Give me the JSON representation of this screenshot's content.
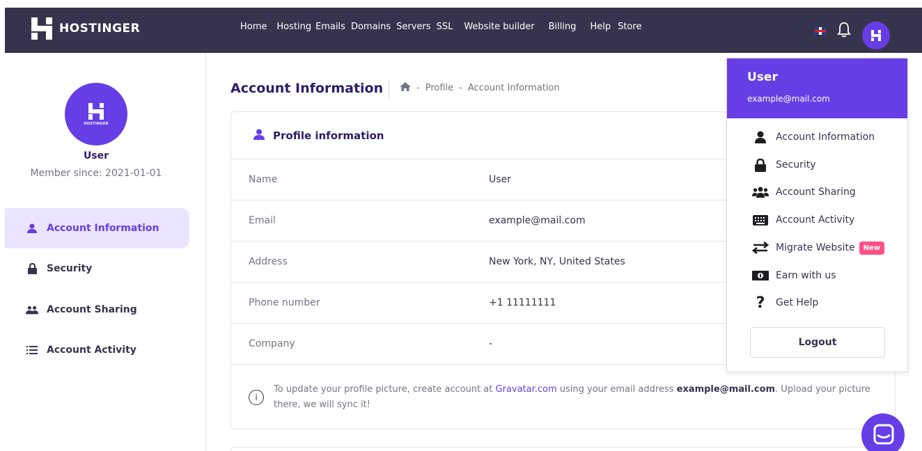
{
  "header": {
    "brand": "HOSTINGER",
    "nav": [
      "Home",
      "Hosting",
      "Emails",
      "Domains",
      "Servers",
      "SSL",
      "Website builder",
      "Billing",
      "Help",
      "Store"
    ]
  },
  "sidebar": {
    "avatar_brand": "HOSTINGER",
    "user": "User",
    "member_since": "Member since: 2021-01-01",
    "items": [
      {
        "label": "Account Information",
        "icon": "person-icon"
      },
      {
        "label": "Security",
        "icon": "lock-icon"
      },
      {
        "label": "Account Sharing",
        "icon": "people-icon"
      },
      {
        "label": "Account Activity",
        "icon": "list-icon"
      }
    ]
  },
  "main": {
    "title": "Account Information",
    "breadcrumb": [
      "Profile",
      "Account Information"
    ],
    "card_title": "Profile information",
    "rows": [
      {
        "key": "Name",
        "value": "User"
      },
      {
        "key": "Email",
        "value": "example@mail.com"
      },
      {
        "key": "Address",
        "value": "New York, NY, United States"
      },
      {
        "key": "Phone number",
        "value": "+1 11111111"
      },
      {
        "key": "Company",
        "value": "-"
      }
    ],
    "note": {
      "prefix": "To update your profile picture, create account at ",
      "link": "Gravatar.com",
      "middle": " using your email address ",
      "email": "example@mail.com",
      "suffix": ". Upload your picture there, we will sync it!"
    }
  },
  "dropdown": {
    "name": "User",
    "email": "example@mail.com",
    "items": [
      {
        "label": "Account Information",
        "icon": "person-icon"
      },
      {
        "label": "Security",
        "icon": "lock-icon"
      },
      {
        "label": "Account Sharing",
        "icon": "people-icon"
      },
      {
        "label": "Account Activity",
        "icon": "keyboard-icon"
      },
      {
        "label": "Migrate Website",
        "icon": "swap-arrows-icon",
        "badge": "New"
      },
      {
        "label": "Earn with us",
        "icon": "money-icon"
      },
      {
        "label": "Get Help",
        "icon": "question-icon"
      }
    ],
    "logout": "Logout"
  },
  "colors": {
    "accent": "#673de6",
    "topbar": "#36344d",
    "badge": "#fc5185"
  }
}
